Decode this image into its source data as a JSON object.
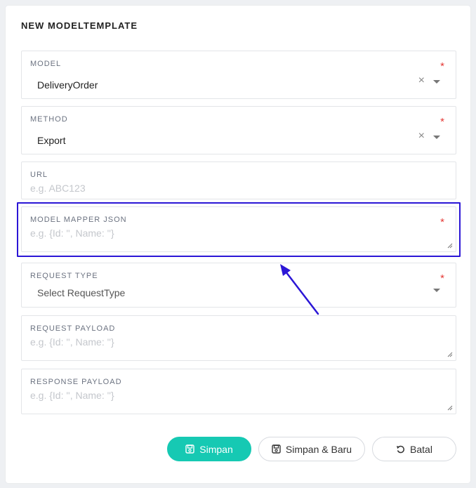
{
  "page": {
    "title": "NEW MODELTEMPLATE"
  },
  "fields": {
    "model": {
      "label": "MODEL",
      "value": "DeliveryOrder",
      "required": "*"
    },
    "method": {
      "label": "METHOD",
      "value": "Export",
      "required": "*"
    },
    "url": {
      "label": "URL",
      "placeholder": "e.g. ABC123"
    },
    "model_mapper_json": {
      "label": "MODEL MAPPER JSON",
      "placeholder": "e.g. {Id: '', Name: ''}",
      "required": "*"
    },
    "request_type": {
      "label": "REQUEST TYPE",
      "placeholder": "Select RequestType",
      "required": "*"
    },
    "request_payload": {
      "label": "REQUEST PAYLOAD",
      "placeholder": "e.g. {Id: '', Name: ''}"
    },
    "response_payload": {
      "label": "RESPONSE PAYLOAD",
      "placeholder": "e.g. {Id: '', Name: ''}"
    }
  },
  "clear_glyph": "×",
  "buttons": {
    "save": "Simpan",
    "save_new": "Simpan & Baru",
    "cancel": "Batal"
  },
  "colors": {
    "accent": "#16c9b3",
    "required": "#e53935",
    "highlight": "#2b16d6"
  },
  "icons": [
    "clear-icon",
    "chevron-down-icon",
    "resize-handle-icon",
    "save-icon",
    "undo-icon",
    "arrow-annotation"
  ]
}
